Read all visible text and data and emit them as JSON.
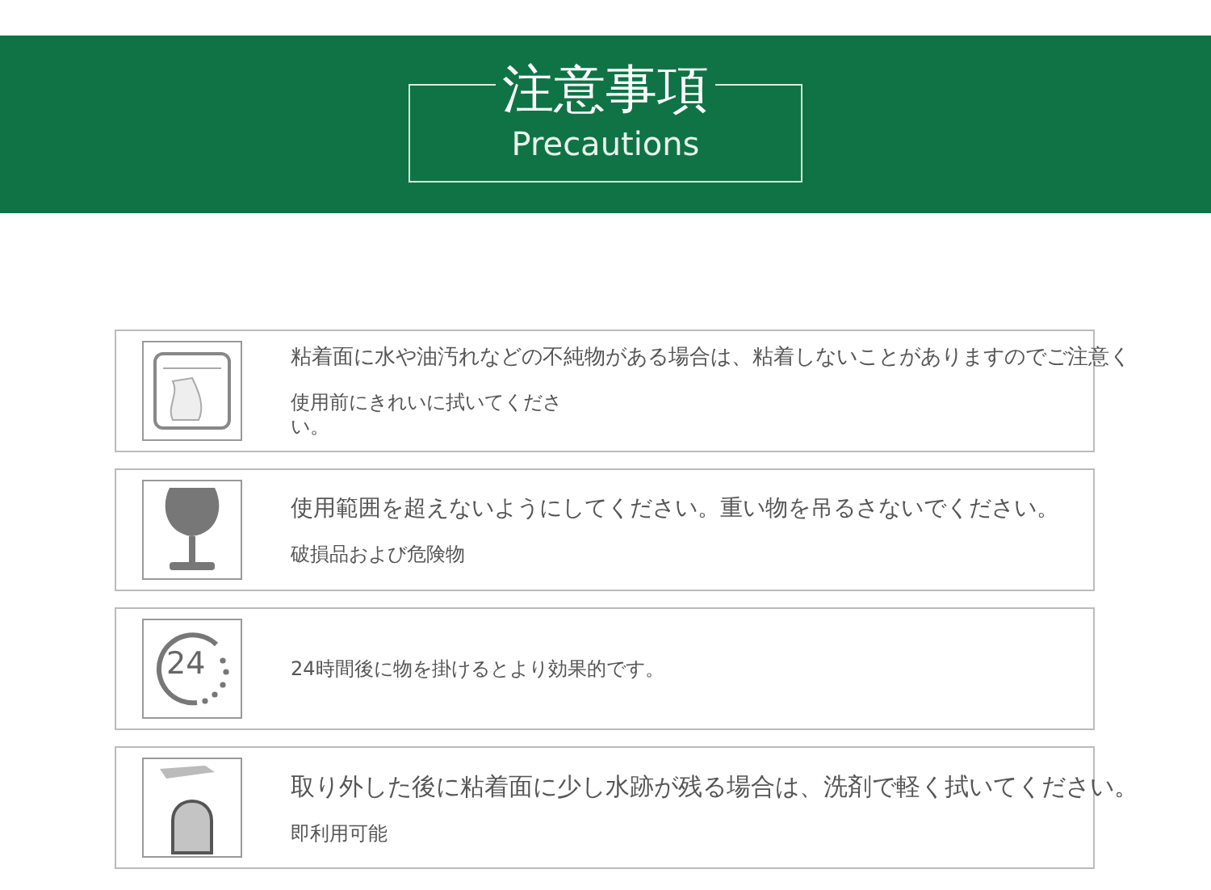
{
  "header": {
    "title": "注意事項",
    "subtitle": "Precautions"
  },
  "items": [
    {
      "kind": "wipe",
      "main": "粘着面に水や油汚れなどの不純物がある場合は、粘着しないことがありますのでご注意く",
      "note": "使用前にきれいに拭いてください。"
    },
    {
      "kind": "glass",
      "main": "使用範囲を超えないようにしてください。重い物を吊るさないでください。",
      "note": "破損品および危険物"
    },
    {
      "kind": "clock",
      "icon_text": "24",
      "note": "24時間後に物を掛けるとより効果的です。"
    },
    {
      "kind": "hook",
      "main": "取り外した後に粘着面に少し水跡が残る場合は、洗剤で軽く拭いてください。",
      "note": "即利用可能"
    }
  ]
}
